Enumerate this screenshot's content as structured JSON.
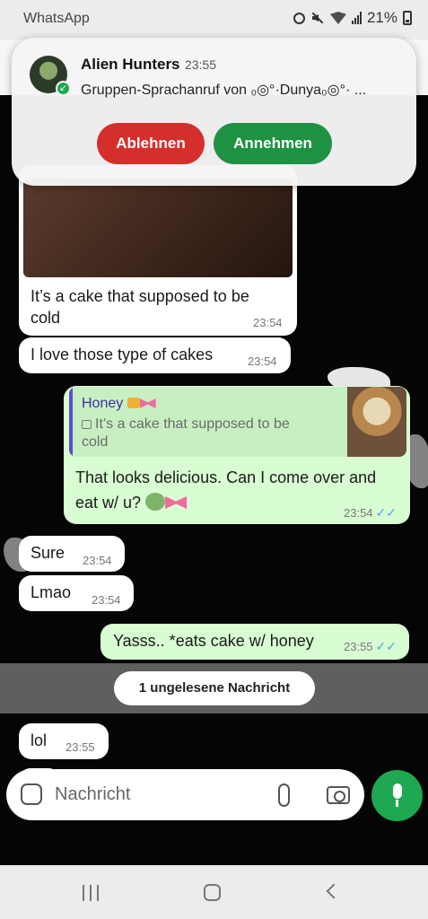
{
  "status_bar": {
    "app_name": "WhatsApp",
    "battery": "21%"
  },
  "notification": {
    "group_name": "Alien Hunters",
    "time": "23:55",
    "text": "Gruppen-Sprachanruf von ₀◎°·Dunya₀◎°· ...",
    "decline_label": "Ablehnen",
    "accept_label": "Annehmen"
  },
  "messages": [
    {
      "dir": "in",
      "text": "It’s a cake that supposed to be cold",
      "time": "23:54"
    },
    {
      "dir": "in",
      "text": "I love those type of cakes",
      "time": "23:54"
    },
    {
      "dir": "out",
      "quote_name": "Honey",
      "quote_text": "It’s a cake that supposed to be cold",
      "text": "That looks delicious. Can I come over and eat w/ u?",
      "time": "23:54"
    },
    {
      "dir": "in",
      "text": "Sure",
      "time": "23:54"
    },
    {
      "dir": "in",
      "text": "Lmao",
      "time": "23:54"
    },
    {
      "dir": "out",
      "text": "Yasss.. *eats cake w/ honey",
      "time": "23:55"
    },
    {
      "dir": "in",
      "text": "lol",
      "time": "23:55"
    }
  ],
  "unread_label": "1 ungelesene Nachricht",
  "composer": {
    "placeholder": "Nachricht"
  },
  "icons": {
    "sticker": "sticker-icon",
    "attach": "paperclip-icon",
    "camera": "camera-icon",
    "mic": "microphone-icon"
  },
  "colors": {
    "accent_green": "#1da851",
    "decline_red": "#d52f2c",
    "accept_green": "#1f9142",
    "outgoing_bubble": "#d8fdd2",
    "read_ticks": "#4fa3e6"
  }
}
